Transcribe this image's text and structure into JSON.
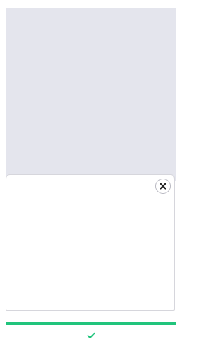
{
  "preview": {
    "background_color": "#e4e5ed"
  },
  "sheet": {
    "close_icon": "close-icon"
  },
  "progress": {
    "fraction": 1.0,
    "color": "#21c47c"
  },
  "confirm": {
    "icon": "checkmark-icon",
    "color": "#21c47c"
  }
}
